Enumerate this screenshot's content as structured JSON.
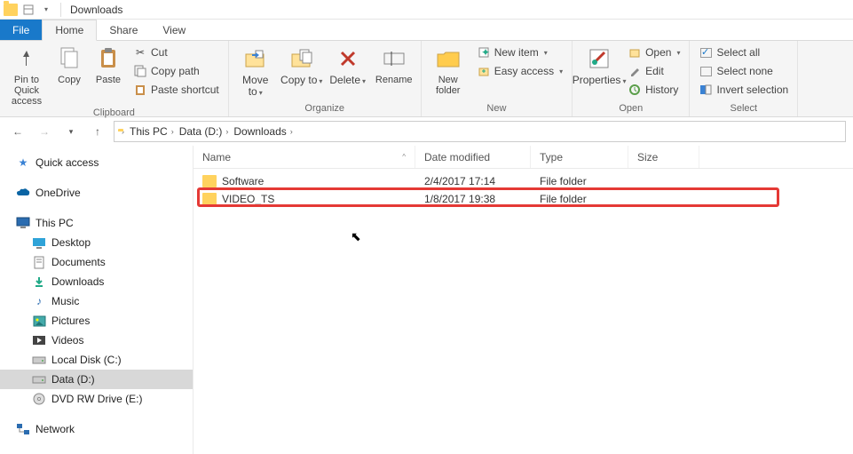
{
  "title": "Downloads",
  "tabs": {
    "file": "File",
    "home": "Home",
    "share": "Share",
    "view": "View"
  },
  "ribbon": {
    "clipboard": {
      "label": "Clipboard",
      "pin": "Pin to Quick access",
      "copy": "Copy",
      "paste": "Paste",
      "cut": "Cut",
      "copypath": "Copy path",
      "pasteshort": "Paste shortcut"
    },
    "organize": {
      "label": "Organize",
      "moveto": "Move to",
      "copyto": "Copy to",
      "delete": "Delete",
      "rename": "Rename"
    },
    "new": {
      "label": "New",
      "newfolder": "New folder",
      "newitem": "New item",
      "easyaccess": "Easy access"
    },
    "open": {
      "label": "Open",
      "properties": "Properties",
      "open": "Open",
      "edit": "Edit",
      "history": "History"
    },
    "select": {
      "label": "Select",
      "all": "Select all",
      "none": "Select none",
      "invert": "Invert selection"
    }
  },
  "breadcrumbs": [
    "This PC",
    "Data (D:)",
    "Downloads"
  ],
  "sidebar": {
    "quick": "Quick access",
    "onedrive": "OneDrive",
    "thispc": "This PC",
    "children": [
      "Desktop",
      "Documents",
      "Downloads",
      "Music",
      "Pictures",
      "Videos",
      "Local Disk (C:)",
      "Data (D:)",
      "DVD RW Drive (E:)"
    ],
    "network": "Network"
  },
  "columns": {
    "name": "Name",
    "date": "Date modified",
    "type": "Type",
    "size": "Size"
  },
  "rows": [
    {
      "name": "Software",
      "date": "2/4/2017 17:14",
      "type": "File folder",
      "size": ""
    },
    {
      "name": "VIDEO_TS",
      "date": "1/8/2017 19:38",
      "type": "File folder",
      "size": ""
    }
  ]
}
